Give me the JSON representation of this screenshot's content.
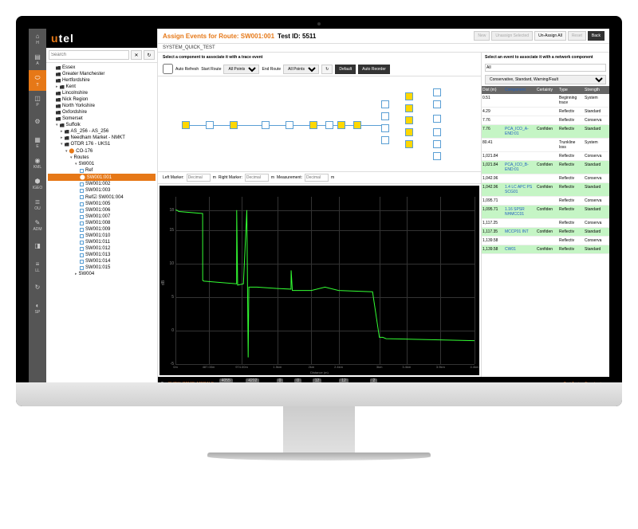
{
  "brand": {
    "pre": "u",
    "post": "tel"
  },
  "leftbar": [
    {
      "icon": "⌂",
      "label": "H"
    },
    {
      "icon": "▤",
      "label": "A"
    },
    {
      "icon": "⬭",
      "label": "T",
      "active": true
    },
    {
      "icon": "◫",
      "label": "P"
    },
    {
      "icon": "⚙",
      "label": ""
    },
    {
      "icon": "▦",
      "label": "E"
    },
    {
      "icon": "◉",
      "label": "KML"
    },
    {
      "icon": "⬢",
      "label": "IGEO"
    },
    {
      "icon": "≣",
      "label": "OU"
    },
    {
      "icon": "✎",
      "label": "ADM"
    },
    {
      "icon": "◨",
      "label": ""
    },
    {
      "icon": "≡",
      "label": "LL"
    },
    {
      "icon": "↻",
      "label": ""
    },
    {
      "icon": "◐",
      "label": "SP"
    }
  ],
  "search": {
    "placeholder": "Search",
    "clear": "✕",
    "refresh": "↻"
  },
  "tree": [
    {
      "ind": 1,
      "icon": "folder",
      "label": "Essex"
    },
    {
      "ind": 1,
      "icon": "folder",
      "label": "Greater Manchester"
    },
    {
      "ind": 1,
      "icon": "folder",
      "label": "Hertfordshire"
    },
    {
      "ind": 1,
      "icon": "folder",
      "label": "Kent",
      "arrow": "▸"
    },
    {
      "ind": 1,
      "icon": "folder",
      "label": "Lincolnshire"
    },
    {
      "ind": 1,
      "icon": "folder",
      "label": "Nick Region"
    },
    {
      "ind": 1,
      "icon": "folder",
      "label": "North Yorkshire"
    },
    {
      "ind": 1,
      "icon": "folder",
      "label": "Oxfordshire"
    },
    {
      "ind": 1,
      "icon": "folder",
      "label": "Somerset"
    },
    {
      "ind": 1,
      "icon": "folder",
      "label": "Suffolk",
      "arrow": "▾"
    },
    {
      "ind": 2,
      "icon": "folder",
      "label": "AS_256 - AS_256",
      "arrow": "▸"
    },
    {
      "ind": 2,
      "icon": "folder",
      "label": "Needham Market - NMKT",
      "arrow": "▸"
    },
    {
      "ind": 2,
      "icon": "folder",
      "label": "OTDR 176 - UKS1",
      "arrow": "▾"
    },
    {
      "ind": 3,
      "icon": "dot",
      "label": "CO-176",
      "arrow": "▾"
    },
    {
      "ind": 4,
      "icon": "",
      "label": "Routes",
      "arrow": "▾"
    },
    {
      "ind": 5,
      "icon": "",
      "label": "SW001",
      "arrow": "▾"
    },
    {
      "ind": 6,
      "icon": "sq",
      "label": "Ref"
    },
    {
      "ind": 6,
      "icon": "sel",
      "label": "SW001:001",
      "sel": true
    },
    {
      "ind": 6,
      "icon": "sq",
      "label": "SW001:002"
    },
    {
      "ind": 6,
      "icon": "sq",
      "label": "SW001:003"
    },
    {
      "ind": 6,
      "icon": "sq",
      "label": "Ref☑ SW001:004"
    },
    {
      "ind": 6,
      "icon": "sq",
      "label": "SW001:005"
    },
    {
      "ind": 6,
      "icon": "sq",
      "label": "SW001:006"
    },
    {
      "ind": 6,
      "icon": "sq",
      "label": "SW001:007"
    },
    {
      "ind": 6,
      "icon": "sq",
      "label": "SW001:008"
    },
    {
      "ind": 6,
      "icon": "sq",
      "label": "SW001:009"
    },
    {
      "ind": 6,
      "icon": "sq",
      "label": "SW001:010"
    },
    {
      "ind": 6,
      "icon": "sq",
      "label": "SW001:011"
    },
    {
      "ind": 6,
      "icon": "sq",
      "label": "SW001:012"
    },
    {
      "ind": 6,
      "icon": "sq",
      "label": "SW001:013"
    },
    {
      "ind": 6,
      "icon": "sq",
      "label": "SW001:014"
    },
    {
      "ind": 6,
      "icon": "sq",
      "label": "SW001:015"
    },
    {
      "ind": 5,
      "icon": "",
      "label": "SW004",
      "arrow": "▸"
    }
  ],
  "titlebar": {
    "route_label": "Assign Events for Route: SW001:001",
    "test_label": "Test ID: 5511",
    "actions": {
      "new": "New",
      "unassign_selected": "Unassign Selected",
      "unassign_all": "Un-Assign All",
      "reset": "Reset",
      "back": "Back"
    }
  },
  "subtitle": "SYSTEM_QUICK_TEST",
  "center": {
    "instruction": "Select a component to associate it with a trace event",
    "toolbar": {
      "auto_refresh": "Auto Refresh",
      "start_route": "Start Route",
      "all_points_1": "All Points",
      "end_route": "End Route",
      "all_points_2": "All Points",
      "refresh": "↻",
      "default": "Default",
      "auto_reorder": "Auto Reorder"
    },
    "markers": {
      "left": "Left Marker:",
      "right": "Right Marker:",
      "measurement": "Measurement:",
      "decimal": "Decimal",
      "unit": "m"
    }
  },
  "chart_data": {
    "type": "line",
    "title": "",
    "xlabel": "Distance (m)",
    "ylabel": "dB",
    "xlim": [
      0,
      4400
    ],
    "ylim": [
      -5,
      20
    ],
    "x_ticks": [
      0,
      487,
      974,
      1500,
      2000,
      2400,
      3000,
      3400,
      3900,
      4400
    ],
    "x_tick_labels": [
      "0m",
      "487.00m",
      "974.00m",
      "1.5km",
      "2km",
      "2.4km",
      "3km",
      "3.4km",
      "3.9km",
      "4.4km"
    ],
    "y_ticks": [
      -5,
      0,
      5,
      10,
      15,
      18
    ],
    "series": [
      {
        "name": "trace",
        "color": "#33ff33",
        "x": [
          0,
          20,
          50,
          400,
          401,
          420,
          900,
          901,
          915,
          1000,
          1050,
          1070,
          1080,
          1200,
          1500,
          1700,
          1702,
          1720,
          2000,
          2200,
          2400,
          2900,
          3000,
          3050,
          3100,
          4400
        ],
        "y": [
          18,
          18,
          17.8,
          17.5,
          7.5,
          7.4,
          7.0,
          18,
          6.8,
          7.0,
          18,
          -4,
          6.5,
          6.5,
          6.3,
          6.2,
          9,
          6.0,
          6.0,
          6.5,
          6.0,
          5.8,
          -1,
          -1,
          -1.2,
          -1.5
        ]
      }
    ]
  },
  "rightpanel": {
    "instruction": "Select an event to associate it with a network component",
    "filter_all": "All",
    "filter_dropdown": "Conservative, Standard, Warning/Fault",
    "headers": {
      "dist": "Dist (m)",
      "comp": "Component",
      "cert": "Certainty",
      "type": "Type",
      "str": "Strength"
    },
    "rows": [
      {
        "dist": "0.51",
        "comp": "",
        "cert": "",
        "type": "Beginning trace",
        "str": "System"
      },
      {
        "dist": "4.29",
        "comp": "",
        "cert": "",
        "type": "Reflectiv",
        "str": "Standard"
      },
      {
        "dist": "7.76",
        "comp": "",
        "cert": "",
        "type": "Reflectiv",
        "str": "Conserva"
      },
      {
        "dist": "7.76",
        "comp": "PCA_ICO_A-END:01",
        "cert": "Confiden",
        "type": "Reflectiv",
        "str": "Standard",
        "hl": true
      },
      {
        "dist": "80.41",
        "comp": "",
        "cert": "",
        "type": "Trunkline loss",
        "str": "System"
      },
      {
        "dist": "1,021.84",
        "comp": "",
        "cert": "",
        "type": "Reflectiv",
        "str": "Conserva"
      },
      {
        "dist": "1,021.84",
        "comp": "PCA_ICO_B-END:01",
        "cert": "Confiden",
        "type": "Reflectiv",
        "str": "Standard",
        "hl": true
      },
      {
        "dist": "1,042.96",
        "comp": "",
        "cert": "",
        "type": "Reflectiv",
        "str": "Conserva"
      },
      {
        "dist": "1,042.96",
        "comp": "1.4 LC APC PS SCG01",
        "cert": "Confiden",
        "type": "Reflectiv",
        "str": "Standard",
        "hl": true
      },
      {
        "dist": "1,095.71",
        "comp": "",
        "cert": "",
        "type": "Reflectiv",
        "str": "Conserva"
      },
      {
        "dist": "1,095.71",
        "comp": "1.16 SPSR NHMCC01",
        "cert": "Confiden",
        "type": "Reflectiv",
        "str": "Standard",
        "hl": true
      },
      {
        "dist": "1,117.25",
        "comp": "",
        "cert": "",
        "type": "Reflectiv",
        "str": "Conserva"
      },
      {
        "dist": "1,117.35",
        "comp": "MCCP01 INT",
        "cert": "Confiden",
        "type": "Reflectiv",
        "str": "Standard",
        "hl": true
      },
      {
        "dist": "1,139.58",
        "comp": "",
        "cert": "",
        "type": "Reflectiv",
        "str": "Conserva"
      },
      {
        "dist": "1,139.58",
        "comp": "CW01",
        "cert": "Confiden",
        "type": "Reflectiv",
        "str": "Standard",
        "hl": true
      }
    ]
  },
  "footer": {
    "show_demo": "SHOW_DEMO_MODALS",
    "items": [
      {
        "badge": "4055",
        "label": "All Tests"
      },
      {
        "badge": "4202",
        "label": "Scheduled Tests"
      },
      {
        "badge": "0",
        "label": "My Tests"
      },
      {
        "badge": "0",
        "label": "Faults"
      },
      {
        "badge": "12",
        "label": "All Alarms"
      },
      {
        "badge": "12",
        "label": "All Live Alarms"
      },
      {
        "badge": "2",
        "label": "Tests Queued"
      }
    ],
    "right": "Test Assign Events view"
  }
}
